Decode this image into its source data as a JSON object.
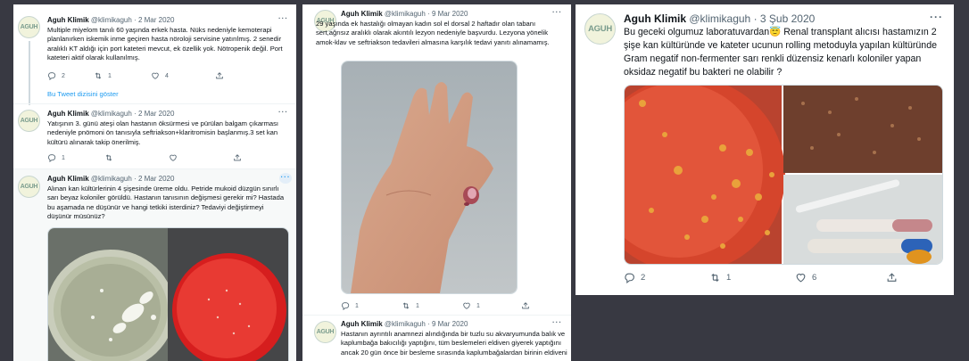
{
  "panel1": {
    "tweets": [
      {
        "avatar": "AGUH",
        "name": "Aguh Klimik",
        "handle": "@klimikaguh",
        "date": "· 2 Mar 2020",
        "more": "···",
        "text": "Multiple miyelom tanılı 60 yaşında erkek hasta. Nüks nedeniyle kemoterapi planlanırken iskemik inme geçiren hasta nöroloji servisine yatırılmış. 2 senedir aralıklı KT aldığı için port kateteri mevcut, ek özellik yok. Nötropenik değil. Port kateteri aktif olarak kullanılmış.",
        "replies": "2",
        "retweets": "1",
        "likes": "4",
        "show_thread": "Bu Tweet dizisini göster"
      },
      {
        "avatar": "AGUH",
        "name": "Aguh Klimik",
        "handle": "@klimikaguh",
        "date": "· 2 Mar 2020",
        "more": "···",
        "text": "Yatışının 3. günü ateşi olan hastanın öksürmesi ve pürülan balgam çıkarması nedeniyle pnömoni ön tanısıyla seftriakson+klaritromisin başlanmış.3 set kan kültürü alınarak takip önerilmiş.",
        "replies": "1",
        "retweets": "",
        "likes": ""
      },
      {
        "avatar": "AGUH",
        "name": "Aguh Klimik",
        "handle": "@klimikaguh",
        "date": "· 2 Mar 2020",
        "more": "···",
        "text": "Alınan kan kültürlerinin 4 şişesinde üreme oldu. Petride mukoid düzgün sınırlı sarı beyaz koloniler görüldü. Hastanın tanısının değişmesi gerekir mi? Hastada bu aşamada ne düşünür ve hangi tetkiki isterdiniz? Tedaviyi değiştirmeyi düşünür müsünüz?"
      }
    ]
  },
  "panel2": {
    "tweets": [
      {
        "name": "Aguh Klimik",
        "handle": "@klimikaguh",
        "date": "· 9 Mar 2020",
        "more": "···",
        "avatar": "AGUH",
        "text": "29 yaşında ek hastalığı olmayan kadın sol el dorsal 2 haftadır olan tabanı sert,ağrısız aralıklı olarak akıntılı lezyon nedeniyle başvurdu. Lezyona yönelik amok-klav ve seftriakson tedavileri almasına karşılık tedavi yanıtı alınamamış.",
        "replies": "1",
        "retweets": "1",
        "likes": "1"
      },
      {
        "avatar": "AGUH",
        "name": "Aguh Klimik",
        "handle": "@klimikaguh",
        "date": "· 9 Mar 2020",
        "more": "···",
        "text": "Hastanın ayrıntılı anamnezi alındığında bir tuzlu su akvaryumunda balık ve kaplumbağa bakıcılığı yaptığını, tüm beslemeleri eldiven giyerek yaptığını ancak 20 gün önce bir besleme sırasında kaplumbağalardan birinin eldiveni"
      }
    ]
  },
  "panel3": {
    "avatar": "AGUH",
    "name": "Aguh Klimik",
    "handle": "@klimikaguh",
    "date": "· 3 Şub 2020",
    "more": "···",
    "text": "Bu geceki olgumuz laboratuvardan😇 Renal transplant alıcısı hastamızın 2 şişe kan kültüründe ve kateter ucunun rolling metoduyla yapılan kültüründe Gram negatif non-fermenter sarı renkli düzensiz kenarlı koloniler yapan oksidaz negatif bu bakteri ne olabilir ?",
    "replies": "2",
    "retweets": "1",
    "likes": "6"
  },
  "colors": {
    "background": "#383942",
    "link": "#1d9bf0",
    "muted": "#536471",
    "agar_red": "#c8301f"
  },
  "icons": [
    "reply-icon",
    "retweet-icon",
    "like-icon",
    "share-icon",
    "more-icon"
  ]
}
